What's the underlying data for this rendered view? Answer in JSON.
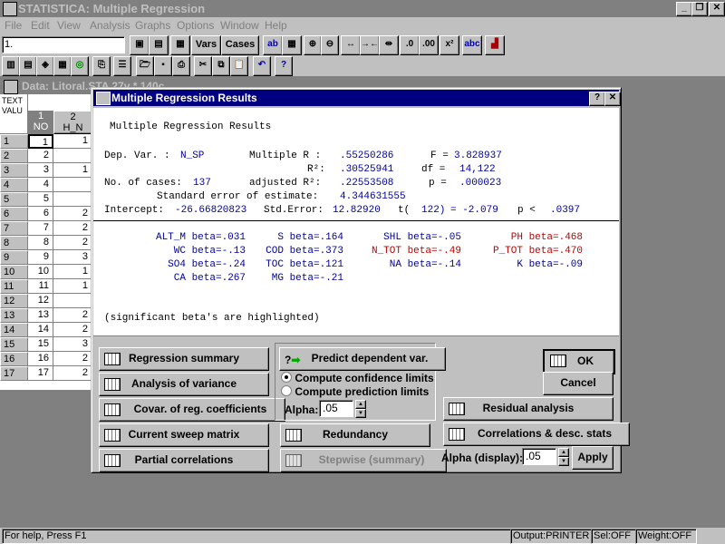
{
  "app": {
    "title": "STATISTICA: Multiple Regression",
    "controls": [
      "_",
      "❐",
      "✕"
    ]
  },
  "menu": [
    "File",
    "Edit",
    "View",
    "Analysis",
    "Graphs",
    "Options",
    "Window",
    "Help"
  ],
  "toolbar": {
    "cell_ref": "1.",
    "vars_label": "Vars",
    "cases_label": "Cases"
  },
  "sheet": {
    "title": "Data: Litoral.STA 27v * 140c",
    "text_header": [
      "TEXT",
      "VALU"
    ],
    "col1_header": [
      "1",
      "NO"
    ],
    "col2_header": [
      "2",
      "H_N"
    ],
    "rows": [
      {
        "h": "1",
        "no": "1",
        "v": "1"
      },
      {
        "h": "2",
        "no": "2",
        "v": ""
      },
      {
        "h": "3",
        "no": "3",
        "v": "1"
      },
      {
        "h": "4",
        "no": "4",
        "v": ""
      },
      {
        "h": "5",
        "no": "5",
        "v": ""
      },
      {
        "h": "6",
        "no": "6",
        "v": "2"
      },
      {
        "h": "7",
        "no": "7",
        "v": "2"
      },
      {
        "h": "8",
        "no": "8",
        "v": "2"
      },
      {
        "h": "9",
        "no": "9",
        "v": "3"
      },
      {
        "h": "10",
        "no": "10",
        "v": "1"
      },
      {
        "h": "11",
        "no": "11",
        "v": "1"
      },
      {
        "h": "12",
        "no": "12",
        "v": ""
      },
      {
        "h": "13",
        "no": "13",
        "v": "2"
      },
      {
        "h": "14",
        "no": "14",
        "v": "2"
      },
      {
        "h": "15",
        "no": "15",
        "v": "3"
      },
      {
        "h": "16",
        "no": "16",
        "v": "2"
      },
      {
        "h": "17",
        "no": "17",
        "v": "2"
      }
    ]
  },
  "dialog": {
    "title": "Multiple Regression Results",
    "heading": "Multiple Regression Results",
    "stats": {
      "dep_label": "Dep. Var. :",
      "dep_value": "N_SP",
      "mult_r_label": "Multiple R :",
      "mult_r": ".55250286",
      "f_label": "F =",
      "f_value": "3.828937",
      "r2_label": "R²:",
      "r2": ".30525941",
      "df_label": "df =",
      "df_value": "14,122",
      "ncases_label": "No. of cases:",
      "ncases": "137",
      "adj_label": "adjusted R²:",
      "adj_r2": ".22553508",
      "p_label": "p =",
      "p_value": ".000023",
      "se_label": "Standard error of estimate:",
      "se_value": "4.344631555",
      "intercept_label": "Intercept:",
      "intercept_value": "-26.66820823",
      "stderr_label": "Std.Error:",
      "stderr_value": "12.82920",
      "t_label": "t(",
      "t_df": "122)",
      "t_eq": "= -2.079",
      "p2_label": "p <",
      "p2_value": ".0397"
    },
    "betas": [
      {
        "text": "ALT_M beta=.031",
        "sig": false
      },
      {
        "text": "S beta=.164",
        "sig": false
      },
      {
        "text": "SHL beta=-.05",
        "sig": false
      },
      {
        "text": "PH beta=.468",
        "sig": true
      },
      {
        "text": "WC beta=-.13",
        "sig": false
      },
      {
        "text": "COD beta=.373",
        "sig": false
      },
      {
        "text": "N_TOT beta=-.49",
        "sig": true
      },
      {
        "text": "P_TOT beta=.470",
        "sig": true
      },
      {
        "text": "SO4 beta=-.24",
        "sig": false
      },
      {
        "text": "TOC beta=.121",
        "sig": false
      },
      {
        "text": "NA beta=-.14",
        "sig": false
      },
      {
        "text": "K beta=-.09",
        "sig": false
      },
      {
        "text": "CA beta=.267",
        "sig": false
      },
      {
        "text": "MG beta=-.21",
        "sig": false
      }
    ],
    "note": "(significant beta's are highlighted)",
    "buttons": {
      "regression_summary": "Regression summary",
      "analysis_of_variance": "Analysis of variance",
      "covar": "Covar. of reg. coefficients",
      "current_sweep": "Current sweep matrix",
      "partial_correlations": "Partial correlations",
      "predict": "Predict dependent var.",
      "confidence": "Compute confidence limits",
      "prediction": "Compute prediction limits",
      "alpha_label": "Alpha:",
      "alpha_value": ".05",
      "redundancy": "Redundancy",
      "stepwise": "Stepwise (summary)",
      "ok": "OK",
      "cancel": "Cancel",
      "residual": "Residual analysis",
      "correlations": "Correlations & desc. stats",
      "alpha_display_label": "Alpha (display):",
      "alpha_display_value": ".05",
      "apply": "Apply"
    }
  },
  "status": {
    "help": "For help, Press F1",
    "output": "Output:PRINTER",
    "sel": "Sel:OFF",
    "weight": "Weight:OFF"
  }
}
